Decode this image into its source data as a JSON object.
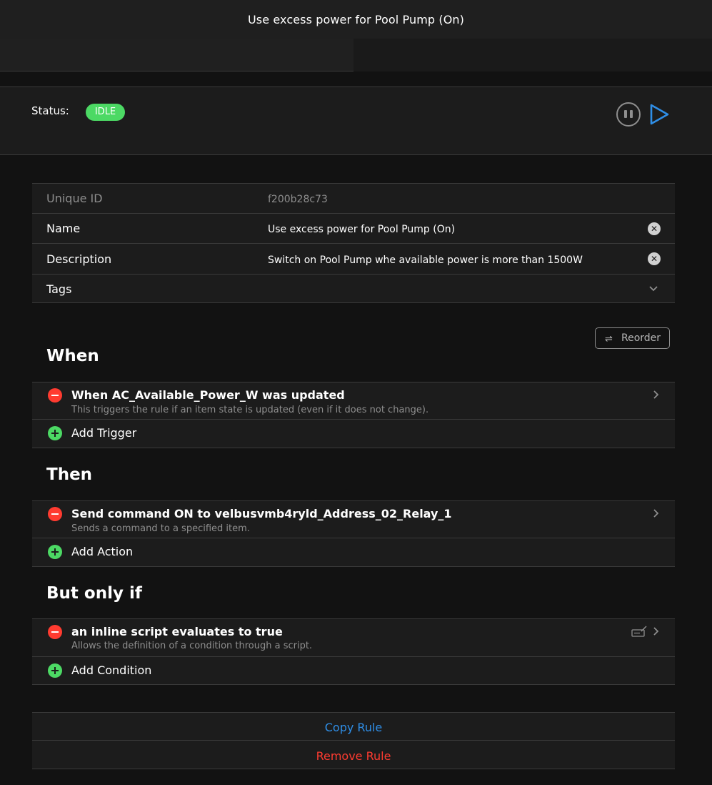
{
  "header": {
    "title": "Use excess power for Pool Pump (On)"
  },
  "status": {
    "label": "Status:",
    "badge": "IDLE",
    "badge_color": "#4cd964"
  },
  "info": {
    "unique_id_label": "Unique ID",
    "unique_id_value": "f200b28c73",
    "name_label": "Name",
    "name_value": "Use excess power for Pool Pump (On)",
    "description_label": "Description",
    "description_value": "Switch on Pool Pump whe available power is more than 1500W",
    "tags_label": "Tags"
  },
  "reorder_label": "Reorder",
  "when": {
    "title": "When",
    "item_title": "When AC_Available_Power_W was updated",
    "item_subtitle": "This triggers the rule if an item state is updated (even if it does not change).",
    "add_label": "Add Trigger"
  },
  "then": {
    "title": "Then",
    "item_title": "Send command ON to velbusvmb4ryld_Address_02_Relay_1",
    "item_subtitle": "Sends a command to a specified item.",
    "add_label": "Add Action"
  },
  "but_only_if": {
    "title": "But only if",
    "item_title": "an inline script evaluates to true",
    "item_subtitle": "Allows the definition of a condition through a script.",
    "add_label": "Add Condition"
  },
  "actions": {
    "copy_label": "Copy Rule",
    "remove_label": "Remove Rule"
  },
  "colors": {
    "accent_blue": "#2f8ee6",
    "danger_red": "#ff3b30",
    "success_green": "#4cd964"
  }
}
